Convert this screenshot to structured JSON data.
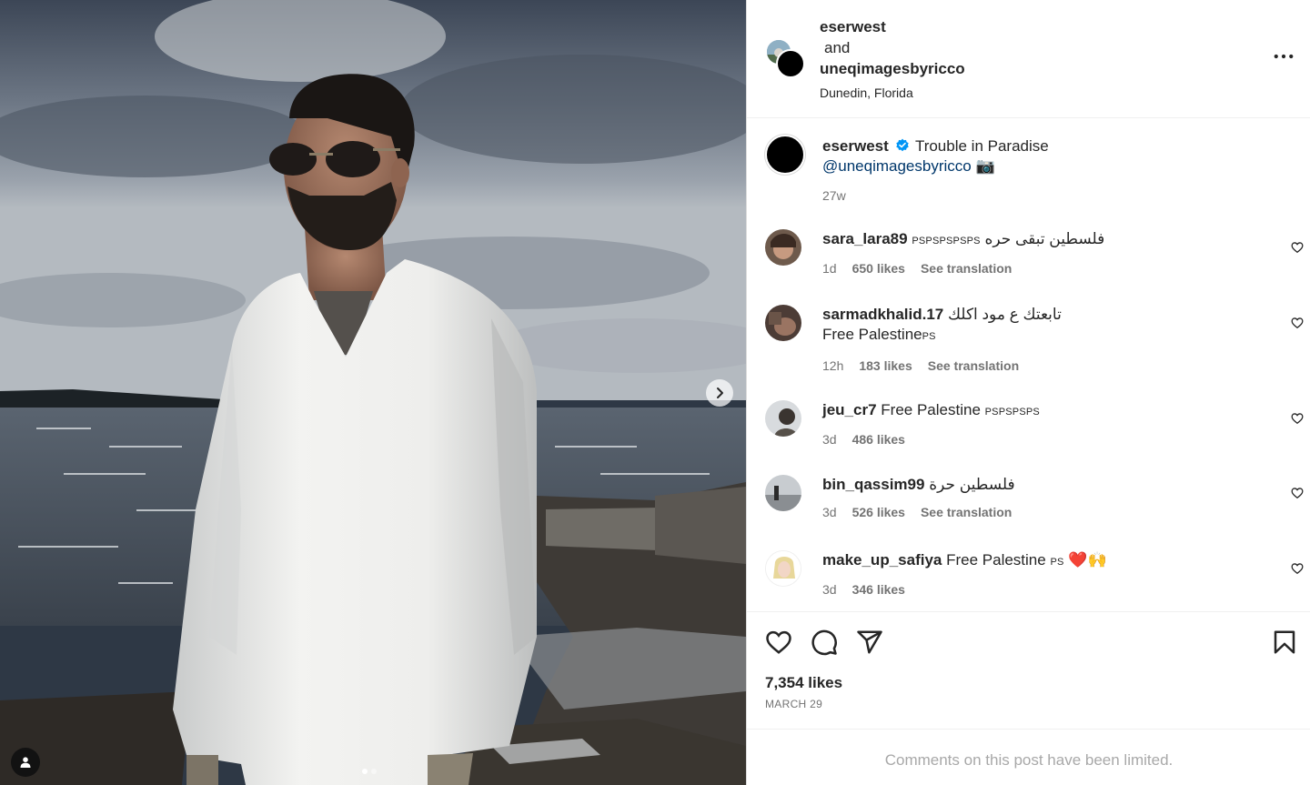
{
  "post": {
    "header": {
      "user1": "eserwest",
      "joiner": "and",
      "user2": "uneqimagesbyricco",
      "location": "Dunedin, Florida"
    },
    "caption": {
      "user": "eserwest",
      "text": "Trouble in Paradise",
      "mention": "@uneqimagesbyricco",
      "emoji": "📷",
      "time": "27w"
    },
    "comments": [
      {
        "user": "sara_lara89",
        "small": "PSPSPSPSPS",
        "text": "فلسطين تبقى حره",
        "time": "1d",
        "likes": "650 likes",
        "see_translation": "See translation"
      },
      {
        "user": "sarmadkhalid.17",
        "text": "تابعتك ع مود اكلك",
        "line2": "Free Palestine",
        "small2": "PS",
        "time": "12h",
        "likes": "183 likes",
        "see_translation": "See translation"
      },
      {
        "user": "jeu_cr7",
        "text": "Free Palestine",
        "small": "PSPSPSPS",
        "time": "3d",
        "likes": "486 likes"
      },
      {
        "user": "bin_qassim99",
        "text": "فلسطين حرة",
        "time": "3d",
        "likes": "526 likes",
        "see_translation": "See translation"
      },
      {
        "user": "make_up_safiya",
        "text": "Free Palestine",
        "small": "PS",
        "emoji": "❤️🙌",
        "time": "3d",
        "likes": "346 likes"
      }
    ],
    "likes": "7,354 likes",
    "date": "MARCH 29",
    "comments_limited": "Comments on this post have been limited.",
    "carousel": {
      "slides": 2,
      "current": 1
    }
  },
  "icons": {
    "more": "more-options-icon",
    "verified": "verified-badge-icon",
    "heart": "heart-icon",
    "comment": "comment-icon",
    "share": "share-icon",
    "save": "bookmark-icon",
    "next": "chevron-right-icon",
    "tag": "user-tag-icon"
  },
  "colors": {
    "verified": "#0095f6",
    "mention": "#00376b",
    "muted": "#737373",
    "heart_red": "#ed4956"
  }
}
